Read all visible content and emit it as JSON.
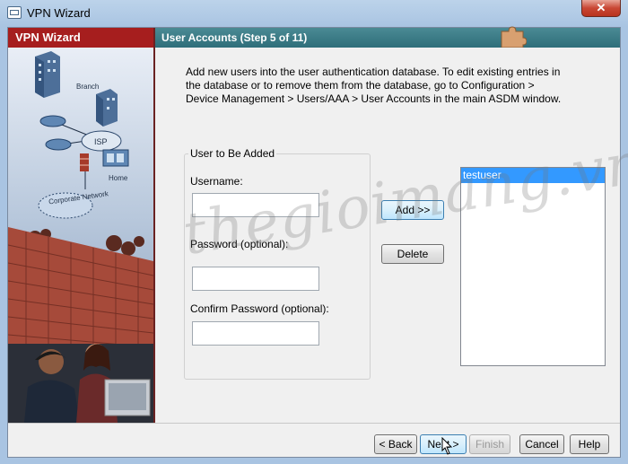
{
  "window": {
    "title": "VPN Wizard",
    "close_label": "✕",
    "icon": "vpn-wizard-app-icon"
  },
  "side_panel": {
    "title": "VPN Wizard",
    "diagram_labels": {
      "branch": "Branch",
      "isp": "ISP",
      "home": "Home",
      "corporate_network": "Corporate Network"
    }
  },
  "step": {
    "title": "User Accounts  (Step 5 of 11)"
  },
  "description": "Add new users into the user authentication database. To edit existing entries in the database or to remove them from the database, go to Configuration > Device Management > Users/AAA > User Accounts in the main ASDM window.",
  "user_group": {
    "legend": "User to Be Added",
    "username_label": "Username:",
    "username_value": "",
    "password_label": "Password (optional):",
    "password_value": "",
    "confirm_label": "Confirm Password (optional):",
    "confirm_value": ""
  },
  "actions": {
    "add_label": "Add >>",
    "delete_label": "Delete"
  },
  "users_list": [
    "testuser"
  ],
  "footer": {
    "back_label": "< Back",
    "next_label": "Next >",
    "finish_label": "Finish",
    "cancel_label": "Cancel",
    "help_label": "Help"
  },
  "watermark": "thegioimang.vn",
  "colors": {
    "side_header": "#a61e1e",
    "content_header": "#3a7a86",
    "selection": "#3399ff"
  }
}
